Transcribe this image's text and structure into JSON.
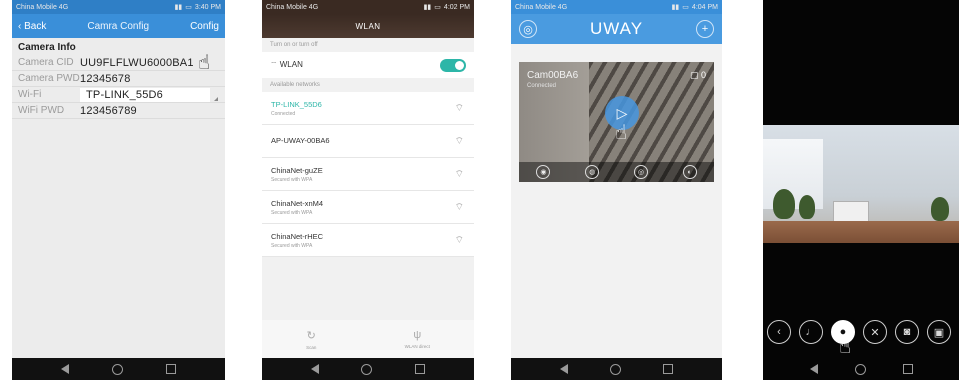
{
  "status_bar": {
    "screen1": {
      "carrier": "China Mobile 4G",
      "time": "3:40 PM"
    },
    "screen2": {
      "carrier": "China Mobile 4G",
      "time": "4:02 PM"
    },
    "screen3": {
      "carrier": "China Mobile 4G",
      "time": "4:04 PM"
    }
  },
  "screen1": {
    "back_label": "Back",
    "title": "Camra Config",
    "config_label": "Config",
    "section_title": "Camera Info",
    "rows": [
      {
        "label": "Camera CID",
        "value": "UU9FLFLWU6000BA1"
      },
      {
        "label": "Camera PWD",
        "value": "12345678"
      },
      {
        "label": "Wi-Fi",
        "value": "TP-LINK_55D6"
      },
      {
        "label": "WiFi PWD",
        "value": "123456789"
      }
    ]
  },
  "screen2": {
    "title": "WLAN",
    "toggle_section": "Turn on or turn off",
    "wlan_label": "WLAN",
    "wlan_enabled": true,
    "available_label": "Available networks",
    "networks": [
      {
        "name": "TP-LINK_55D6",
        "status": "Connected",
        "connected": true
      },
      {
        "name": "AP-UWAY-00BA6",
        "status": "",
        "connected": false
      },
      {
        "name": "ChinaNet-guZE",
        "status": "Secured with WPA",
        "connected": false
      },
      {
        "name": "ChinaNet-xnM4",
        "status": "Secured with WPA",
        "connected": false
      },
      {
        "name": "ChinaNet-rHEC",
        "status": "Secured with WPA",
        "connected": false
      }
    ],
    "tools": [
      {
        "label": "Scan",
        "icon": "refresh-icon"
      },
      {
        "label": "WLAN direct",
        "icon": "wlan-direct-icon"
      }
    ],
    "accent_color": "#2db6a8"
  },
  "screen3": {
    "app_title": "UWAY",
    "camera_name": "Cam00BA6",
    "camera_status": "Connected",
    "camera_count": "0",
    "accent_color": "#4a9be0"
  },
  "screen4": {
    "controls": [
      "back-icon",
      "microphone-icon",
      "talk-icon",
      "mute-icon",
      "snapshot-icon",
      "record-icon"
    ]
  }
}
